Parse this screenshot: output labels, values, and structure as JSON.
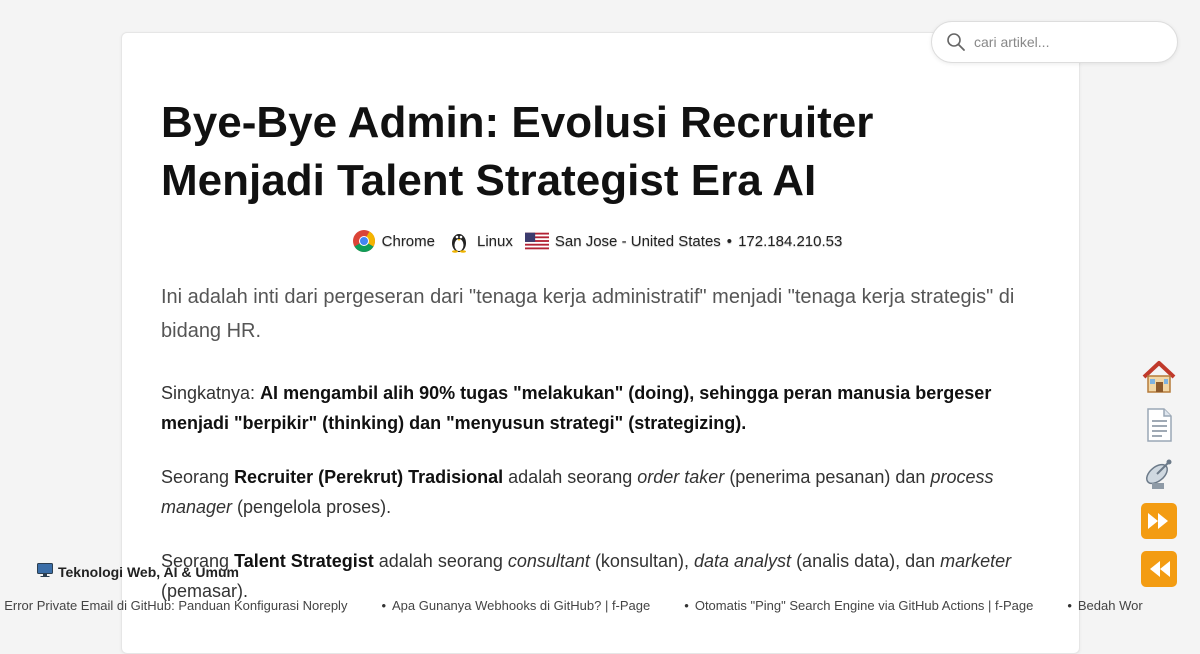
{
  "search": {
    "placeholder": "cari artikel..."
  },
  "article": {
    "title": "Bye-Bye Admin: Evolusi Recruiter Menjadi Talent Strategist Era AI",
    "meta": {
      "browser": "Chrome",
      "os": "Linux",
      "location": "San Jose - United States",
      "separator": "•",
      "ip": "172.184.210.53"
    },
    "lead": "Ini adalah inti dari pergeseran dari \"tenaga kerja administratif\" menjadi \"tenaga kerja strategis\" di bidang HR.",
    "p1": {
      "prefix": "Singkatnya: ",
      "bold": "AI mengambil alih 90% tugas \"melakukan\" (doing), sehingga peran manusia bergeser menjadi \"berpikir\" (thinking) dan \"menyusun strategi\" (strategizing)."
    },
    "p2": {
      "t1": "Seorang ",
      "b1": "Recruiter (Perekrut) Tradisional",
      "t2": " adalah seorang ",
      "i1": "order taker",
      "t3": " (penerima pesanan) dan ",
      "i2": "process manager",
      "t4": " (pengelola proses)."
    },
    "p3": {
      "t1": "Seorang ",
      "b1": "Talent Strategist",
      "t2": " adalah seorang ",
      "i1": "consultant",
      "t3": " (konsultan), ",
      "i2": "data analyst",
      "t4": " (analis data), dan ",
      "i3": "marketer",
      "t5": " (pemasar)."
    }
  },
  "sidenav": {
    "icons": [
      "house-icon",
      "page-icon",
      "satellite-icon",
      "fast-forward-icon",
      "rewind-icon"
    ]
  },
  "category": {
    "icon": "desktop-computer-icon",
    "label": "Teknologi Web, AI & Umum"
  },
  "ticker": {
    "bullet": "•",
    "items": [
      "asi Error Private Email di GitHub: Panduan Konfigurasi Noreply",
      "Apa Gunanya Webhooks di GitHub? | f-Page",
      "Otomatis \"Ping\" Search Engine via GitHub Actions | f-Page",
      "Bedah Wor"
    ]
  }
}
